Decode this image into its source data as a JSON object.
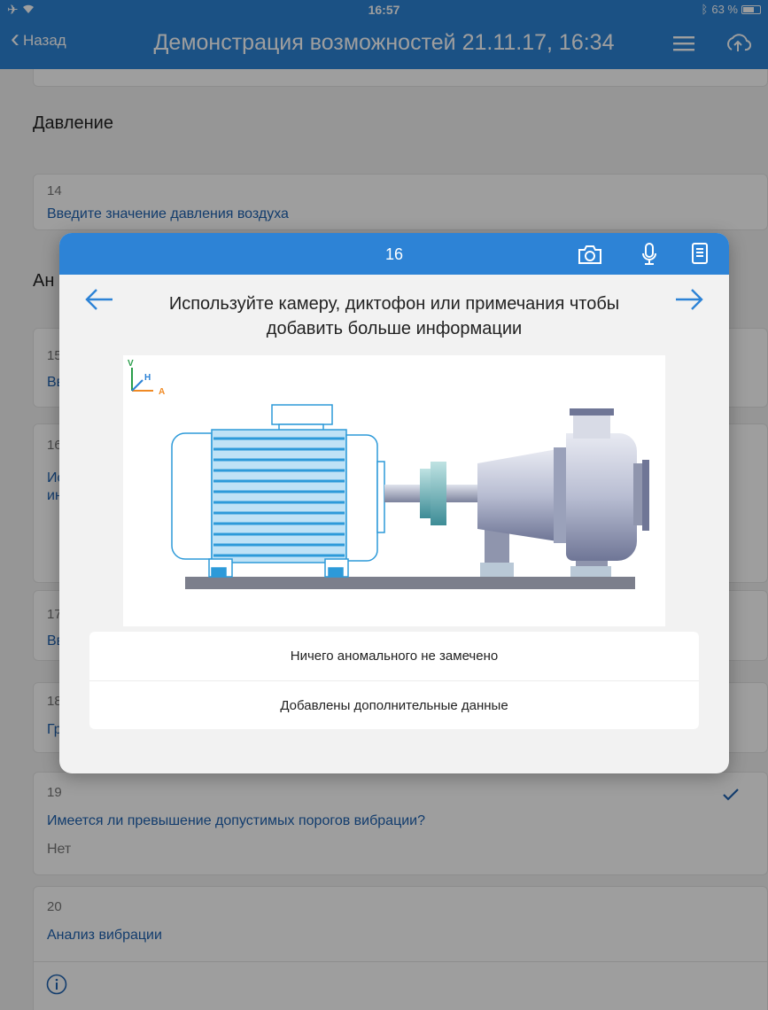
{
  "statusbar": {
    "time": "16:57",
    "battery": "63 %"
  },
  "navbar": {
    "back_label": "Назад",
    "title": "Демонстрация возможностей 21.11.17, 16:34"
  },
  "sections": {
    "pressure": "Давление",
    "analysis_partial": "Ан"
  },
  "cards": {
    "c14": {
      "num": "14",
      "question": "Введите значение давления воздуха"
    },
    "c15": {
      "num": "15",
      "question": "Вв"
    },
    "c16": {
      "num": "16",
      "question": "Ис",
      "question2": "ин"
    },
    "c17": {
      "num": "17",
      "question": "Вв"
    },
    "c18": {
      "num": "18",
      "question": "Гр"
    },
    "c19": {
      "num": "19",
      "question": "Имеется ли превышение допустимых порогов вибрации?",
      "answer": "Нет"
    },
    "c20": {
      "num": "20",
      "question": "Анализ вибрации"
    }
  },
  "modal": {
    "number": "16",
    "instruction": "Используйте камеру, диктофон или примечания чтобы добавить больше информации",
    "options": [
      "Ничего аномального не замечено",
      "Добавлены дополнительные данные"
    ],
    "axes": {
      "v": "V",
      "h": "H",
      "a": "A"
    }
  },
  "colors": {
    "accent": "#2d83d6",
    "link": "#1e62b0"
  },
  "icons": [
    "airplane-icon",
    "wifi-icon",
    "bluetooth-icon",
    "battery-icon",
    "chevron-left-icon",
    "list-icon",
    "upload-icon",
    "camera-icon",
    "microphone-icon",
    "notes-icon",
    "arrow-left-icon",
    "arrow-right-icon",
    "checkmark-icon",
    "info-icon"
  ]
}
